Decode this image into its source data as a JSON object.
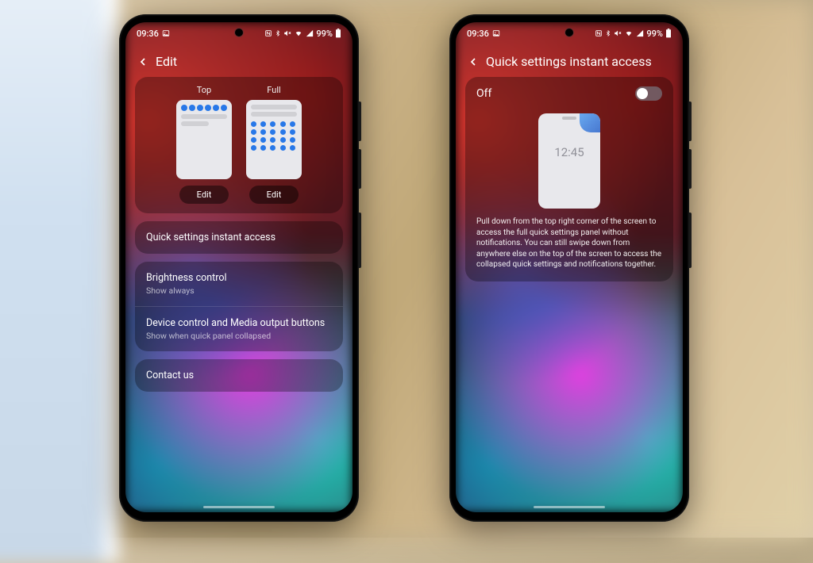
{
  "status": {
    "time": "09:36",
    "battery_pct": "99%"
  },
  "left": {
    "title": "Edit",
    "layout": {
      "top_label": "Top",
      "full_label": "Full",
      "edit_btn": "Edit"
    },
    "instant_access": {
      "title": "Quick settings instant access"
    },
    "brightness": {
      "title": "Brightness control",
      "sub": "Show always"
    },
    "device_media": {
      "title": "Device control and Media output buttons",
      "sub": "Show when quick panel collapsed"
    },
    "contact": {
      "title": "Contact us"
    }
  },
  "right": {
    "title": "Quick settings instant access",
    "toggle_label": "Off",
    "preview_time": "12:45",
    "description": "Pull down from the top right corner of the screen to access the full quick settings panel without notifications. You can still swipe down from anywhere else on the top of the screen to access the collapsed quick settings and notifications together."
  }
}
